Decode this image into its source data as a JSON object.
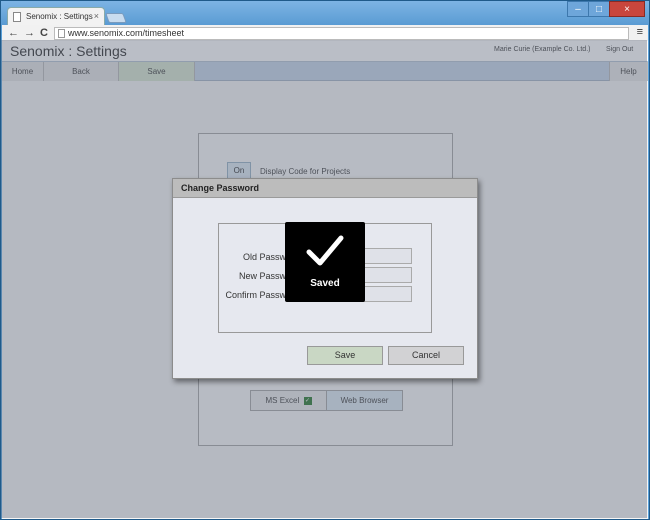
{
  "browser": {
    "tab_title": "Senomix : Settings",
    "url": "www.senomix.com/timesheet",
    "tab_close": "×",
    "nav": {
      "back": "←",
      "forward": "→",
      "reload": "C",
      "menu": "≡"
    },
    "window_controls": {
      "minimize": "–",
      "maximize": "□",
      "close": "×"
    }
  },
  "app": {
    "title": "Senomix : Settings",
    "user": "Marie Curie  (Example Co. Ltd.)",
    "signout": "Sign Out"
  },
  "menubar": {
    "home": "Home",
    "back": "Back",
    "save": "Save",
    "help": "Help"
  },
  "settings": {
    "toggle_value": "On",
    "toggle_label": "Display Code for Projects",
    "export_excel": "MS Excel",
    "export_web": "Web Browser"
  },
  "dialog": {
    "title": "Change Password",
    "old_label": "Old Password",
    "new_label": "New Password",
    "confirm_label": "Confirm Password",
    "save": "Save",
    "cancel": "Cancel"
  },
  "toast": {
    "label": "Saved",
    "icon": "checkmark-icon"
  },
  "colors": {
    "overlay": "#5a6478",
    "toast_bg": "#000000",
    "save_button": "#c9d7c4"
  }
}
